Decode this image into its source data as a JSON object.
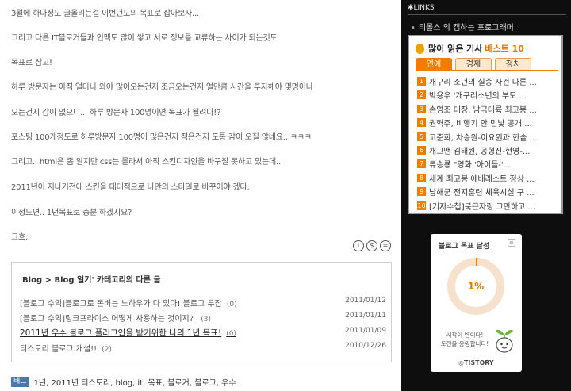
{
  "post": {
    "paragraphs": [
      "3월에 하나정도 글올리는걸 이번년도의 목표로 잡아보자...",
      "그리고 다른 IT블로거들과 인맥도 많이 쌓고 서로 정보를 교류하는 사이가 되는것도",
      "목표로 삼고!",
      "하루 방문자는 아직 얼마나 와야 많이오는건지 조금오는건지 얼만큼 시간을 투자해야 몇명이나",
      "오는건지 감이 없으니... 하루 방문자 100명이면 목표가 될려나!?",
      "포스팅 100개정도로 하루방문자 100명이 많은건지 적은건지 도통 감이 오질 않네요...ㅋㅋㅋ",
      "그리고.. html은 좀 알지만 css는 몰라서 아직 스킨디자인을 바꾸질 못하고 있는데..",
      "2011년이 지나기전에 스킨을 대대적으로 나만의 스타일로 바꾸어야 겠다.",
      "이정도면.. 1년목표로 충분 하겠지요?",
      "크흐.."
    ]
  },
  "related": {
    "title": "'Blog > Blog 일기' 카테고리의 다른 글",
    "items": [
      {
        "text": "[블로그 수익]블로그로 돈버는 노하우가 다 있다! 블로그 투잡",
        "count": "(0)",
        "date": "2011/01/12",
        "highlight": false
      },
      {
        "text": "[블로그 수익]링크프라이스 어떻게 사용하는 것이지? ",
        "count": "(3)",
        "date": "2011/01/11",
        "highlight": false
      },
      {
        "text": "2011년 우수 블로그 플러그인을 받기위한 나의 1년 목표!",
        "count": "(0)",
        "date": "2011/01/09",
        "highlight": true
      },
      {
        "text": "티스토리 블로그 개설!!",
        "count": "(2)",
        "date": "2010/12/26",
        "highlight": false
      }
    ]
  },
  "tags": {
    "label": "태그",
    "list": "1년, 2011년 티스토리, blog, it, 목표, 블로거, 블로그, 우수"
  },
  "sidebar": {
    "links_header": "LINKS",
    "links_item": "티몰스 의 캡하는 프로그래머."
  },
  "popular": {
    "title_prefix": "많이 읽은 기사",
    "title_accent": "베스트 10",
    "tabs": [
      "연예",
      "경제",
      "정치"
    ],
    "active_tab": 0,
    "items": [
      "개구리 소년의 실종 사건 다룬 ...",
      "박용우 '개구리소년의 부모 ...",
      "손영조 대장, 남극대륙 최고봉 ...",
      "권혁주, 비행기 안 민낯 공개 ...",
      "고준희, 차승원-이요원과 한솥 ...",
      "개그맨 김태원, 공형진-현영-...",
      "류승룡 \"영화 '아이들-'...",
      "세계 최고봉 에베레스트 정상 ...",
      "남해군 전지훈련 체육시설 구 ...",
      "[기자수첩]북근자랑 그만하고 ..."
    ],
    "accent_color": "#f07c00"
  },
  "goal": {
    "title": "블로그 목표 달성",
    "percent_label": "1%",
    "progress": 0.01,
    "message_line1": "시작이 반이다!",
    "message_line2": "도전을 응원합니다!",
    "brand": "TISTORY",
    "menu_icon": "list-icon"
  }
}
